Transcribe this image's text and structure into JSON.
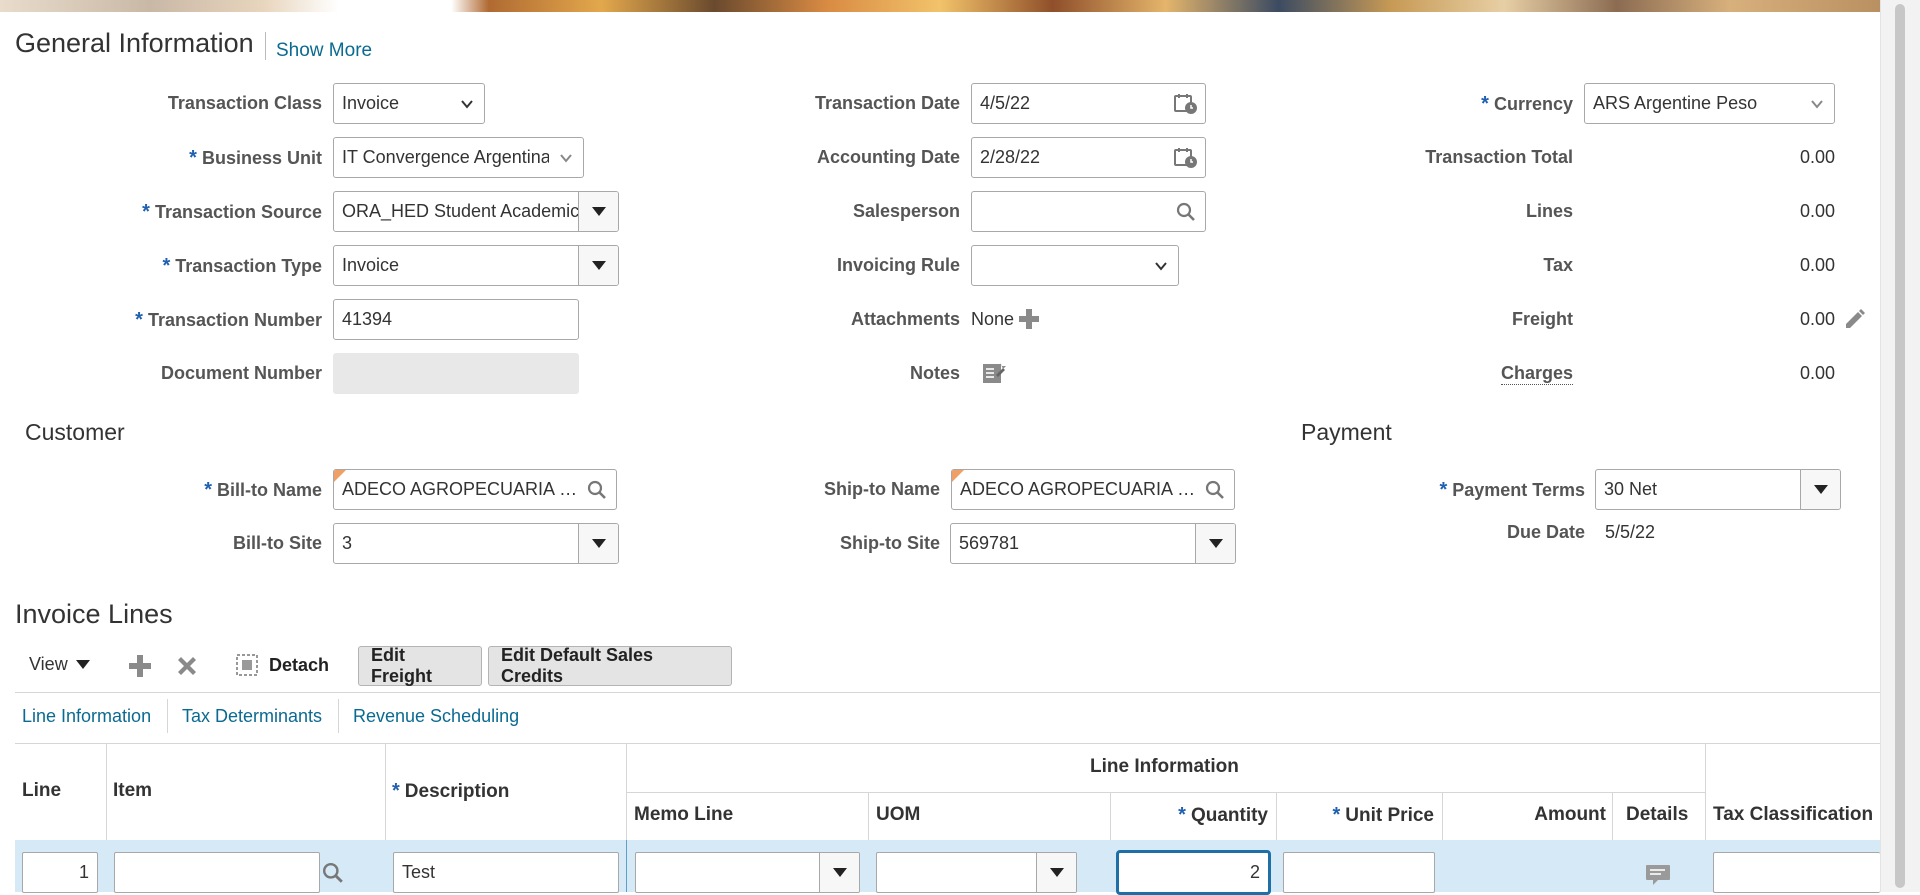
{
  "general": {
    "title": "General Information",
    "show_more": "Show More"
  },
  "left_fields": {
    "transaction_class": {
      "label": "Transaction Class",
      "value": "Invoice"
    },
    "business_unit": {
      "label": "Business Unit",
      "value": "IT Convergence Argentina"
    },
    "transaction_source": {
      "label": "Transaction Source",
      "value": "ORA_HED Student Academic"
    },
    "transaction_type": {
      "label": "Transaction Type",
      "value": "Invoice"
    },
    "transaction_number": {
      "label": "Transaction Number",
      "value": "41394"
    },
    "document_number": {
      "label": "Document Number",
      "value": ""
    }
  },
  "mid_fields": {
    "transaction_date": {
      "label": "Transaction Date",
      "value": "4/5/22"
    },
    "accounting_date": {
      "label": "Accounting Date",
      "value": "2/28/22"
    },
    "salesperson": {
      "label": "Salesperson",
      "value": ""
    },
    "invoicing_rule": {
      "label": "Invoicing Rule",
      "value": ""
    },
    "attachments": {
      "label": "Attachments",
      "value": "None"
    },
    "notes": {
      "label": "Notes"
    }
  },
  "right_fields": {
    "currency": {
      "label": "Currency",
      "value": "ARS Argentine Peso"
    },
    "transaction_total": {
      "label": "Transaction Total",
      "value": "0.00"
    },
    "lines": {
      "label": "Lines",
      "value": "0.00"
    },
    "tax": {
      "label": "Tax",
      "value": "0.00"
    },
    "freight": {
      "label": "Freight",
      "value": "0.00"
    },
    "charges": {
      "label": "Charges",
      "value": "0.00"
    }
  },
  "customer": {
    "title": "Customer",
    "bill_to_name": {
      "label": "Bill-to Name",
      "value": "ADECO AGROPECUARIA S.A."
    },
    "bill_to_site": {
      "label": "Bill-to Site",
      "value": "3"
    },
    "ship_to_name": {
      "label": "Ship-to Name",
      "value": "ADECO AGROPECUARIA S.A."
    },
    "ship_to_site": {
      "label": "Ship-to Site",
      "value": "569781"
    }
  },
  "payment": {
    "title": "Payment",
    "payment_terms": {
      "label": "Payment Terms",
      "value": "30 Net"
    },
    "due_date": {
      "label": "Due Date",
      "value": "5/5/22"
    }
  },
  "invoice_lines": {
    "title": "Invoice Lines",
    "toolbar": {
      "view": "View",
      "detach": "Detach",
      "edit_freight": "Edit Freight",
      "edit_default_sales_credits": "Edit Default Sales Credits"
    },
    "tabs": [
      "Line Information",
      "Tax Determinants",
      "Revenue Scheduling"
    ],
    "group_header": "Line Information",
    "columns": {
      "line": "Line",
      "item": "Item",
      "description": "Description",
      "memo_line": "Memo Line",
      "uom": "UOM",
      "quantity": "Quantity",
      "unit_price": "Unit Price",
      "amount": "Amount",
      "details": "Details",
      "tax_classification": "Tax Classification"
    },
    "rows": [
      {
        "line": "1",
        "item": "",
        "description": "Test",
        "memo_line": "",
        "uom": "",
        "quantity": "2",
        "unit_price": "",
        "amount": "",
        "tax_classification": ""
      }
    ]
  }
}
